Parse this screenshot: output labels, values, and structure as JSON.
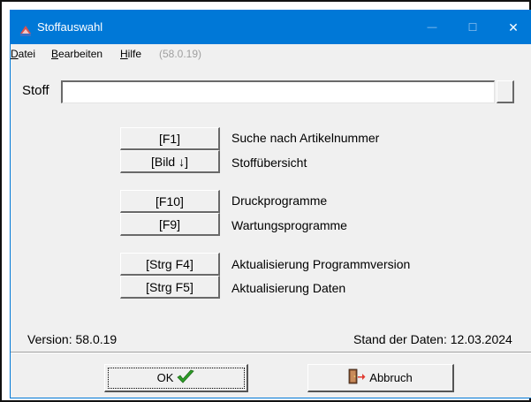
{
  "window": {
    "title": "Stoffauswahl",
    "minimize_glyph": "—",
    "maximize_glyph": "☐",
    "close_glyph": "✕"
  },
  "menu": {
    "datei_rest": "atei",
    "datei_key": "D",
    "bearbeiten_key": "B",
    "bearbeiten_rest": "earbeiten",
    "hilfe_key": "H",
    "hilfe_rest": "ilfe",
    "version": "(58.0.19)"
  },
  "stoff": {
    "label": "Stoff",
    "value": ""
  },
  "functions": [
    {
      "key": "[F1]",
      "label": "Suche nach Artikelnummer"
    },
    {
      "key": "[Bild ↓]",
      "label": "Stoffübersicht"
    },
    {
      "key": "[F10]",
      "label": "Druckprogramme"
    },
    {
      "key": "[F9]",
      "label": "Wartungsprogramme"
    },
    {
      "key": "[Strg F4]",
      "label": "Aktualisierung Programmversion"
    },
    {
      "key": "[Strg F5]",
      "label": "Aktualisierung Daten"
    }
  ],
  "footer": {
    "version_label": "Version:",
    "version_value": "58.0.19",
    "stand_label": "Stand der Daten:",
    "stand_value": "12.03.2024"
  },
  "buttons": {
    "ok": "OK",
    "cancel": "Abbruch"
  },
  "icons": {
    "app": "flask-icon",
    "ok": "checkmark-icon",
    "cancel": "exit-door-icon"
  },
  "colors": {
    "titlebar": "#0078d7",
    "window_bg": "#f0f0f0",
    "check_green": "#2e9e28"
  }
}
